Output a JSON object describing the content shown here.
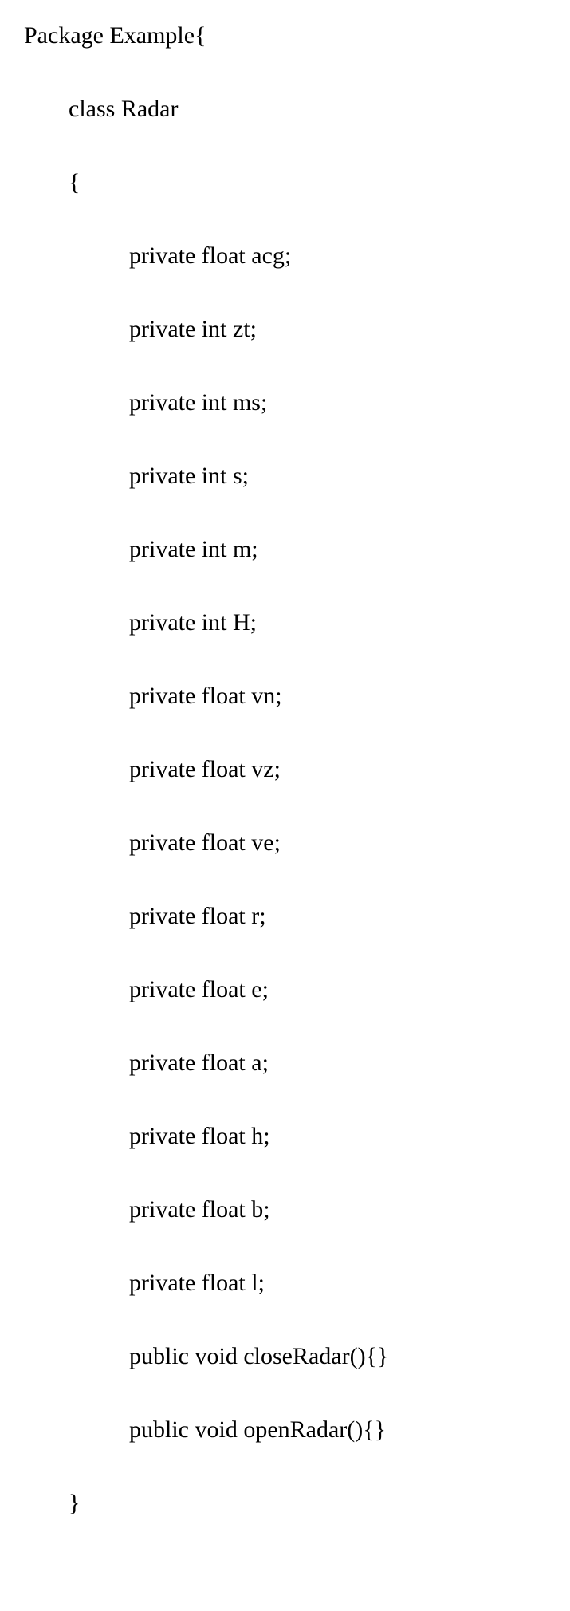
{
  "code": {
    "l0": "Package Example{",
    "l1": "class Radar",
    "l2": "{",
    "l3": "private float acg;",
    "l4": "private int zt;",
    "l5": "private int ms;",
    "l6": "private int s;",
    "l7": "private int m;",
    "l8": "private int H;",
    "l9": "private float vn;",
    "l10": "private float vz;",
    "l11": "private float ve;",
    "l12": "private float r;",
    "l13": "private float e;",
    "l14": "private float a;",
    "l15": "private float h;",
    "l16": "private float b;",
    "l17": "private float l;",
    "l18": "public void closeRadar(){}",
    "l19": "public void openRadar(){}",
    "l20": "}"
  }
}
